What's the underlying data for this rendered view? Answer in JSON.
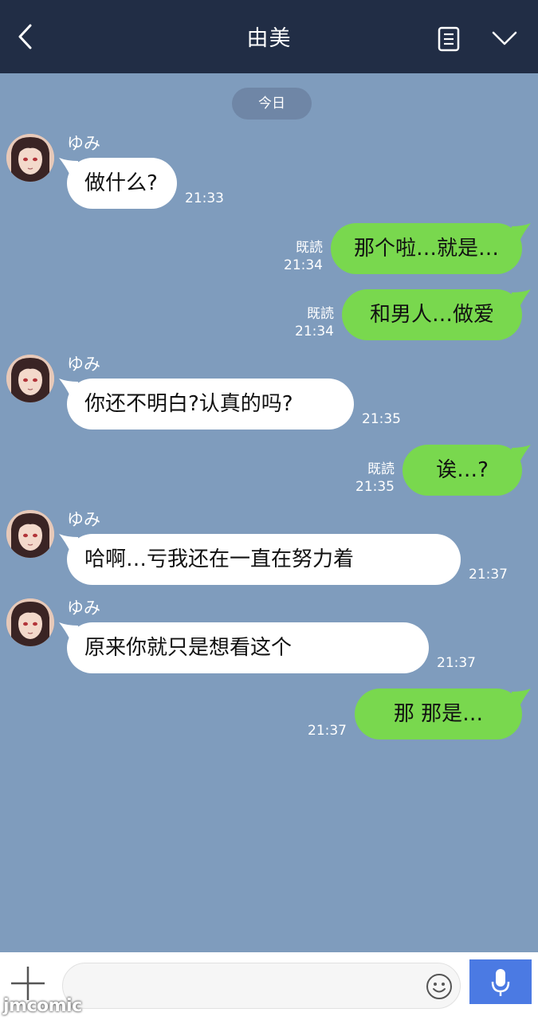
{
  "header": {
    "title": "由美",
    "back_icon": "chevron-left-icon",
    "note_icon": "note-icon",
    "menu_icon": "chevron-down-icon"
  },
  "date_label": "今日",
  "messages": [
    {
      "side": "in",
      "sender": "ゆみ",
      "text": "做什么?",
      "time": "21:33"
    },
    {
      "side": "out",
      "read": "既読",
      "text": "那个啦…就是…",
      "time": "21:34"
    },
    {
      "side": "out",
      "read": "既読",
      "text": "和男人…做爱",
      "time": "21:34"
    },
    {
      "side": "in",
      "sender": "ゆみ",
      "text": "你还不明白?认真的吗?",
      "time": "21:35"
    },
    {
      "side": "out",
      "read": "既読",
      "text": "诶…?",
      "time": "21:35"
    },
    {
      "side": "in",
      "sender": "ゆみ",
      "text": "哈啊…亏我还在一直在努力着",
      "time": "21:37"
    },
    {
      "side": "in",
      "sender": "ゆみ",
      "text": "原来你就只是想看这个",
      "time": "21:37"
    },
    {
      "side": "out",
      "read": "",
      "text": "那 那是…",
      "time": "21:37"
    }
  ],
  "composer": {
    "placeholder": "",
    "plus_icon": "plus-icon",
    "emoji_icon": "emoji-icon",
    "mic_icon": "mic-icon"
  },
  "watermark": "jmcomic",
  "colors": {
    "header": "#212d45",
    "chat_bg": "#7f9cbd",
    "outgoing": "#79d84e",
    "incoming": "#ffffff",
    "mic": "#4b7ae3"
  }
}
